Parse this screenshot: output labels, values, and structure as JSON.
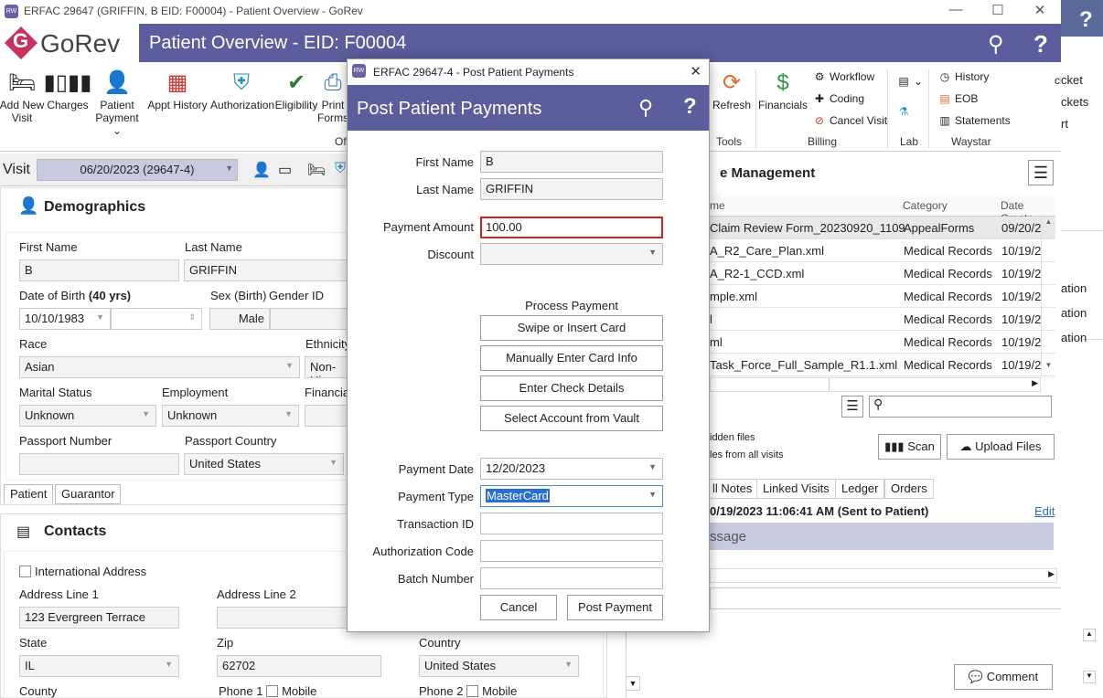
{
  "window": {
    "title": "ERFAC 29647 (GRIFFIN, B EID: F00004) - Patient Overview - GoRev",
    "minimize": "—",
    "maximize": "☐",
    "close": "✕"
  },
  "app": {
    "logo_text": "GoRev",
    "logo_letter": "G",
    "header_title": "Patient Overview - EID: F00004",
    "help": "?"
  },
  "ribbon": {
    "add_new_visit": [
      "Add New",
      "Visit"
    ],
    "charges": "Charges",
    "patient_payment": [
      "Patient",
      "Payment ⌄"
    ],
    "appt_history": "Appt History",
    "authorization": "Authorization",
    "eligibility": "Eligibility",
    "print_forms": [
      "Print",
      "Forms"
    ],
    "group_of": "Of",
    "refresh": "Refresh",
    "tools": "Tools",
    "financials": "Financials",
    "workflow": "Workflow",
    "coding": "Coding",
    "cancel_visit": "Cancel Visit",
    "billing": "Billing",
    "lab": "Lab",
    "history": "History",
    "eob": "EOB",
    "statements": "Statements",
    "waystar": "Waystar",
    "partial1": "cket",
    "partial2": "ckets",
    "partial3": "rt"
  },
  "visit": {
    "label": "Visit",
    "selected": "06/20/2023 (29647-4)"
  },
  "demographics": {
    "title": "Demographics",
    "first_name_label": "First Name",
    "first_name": "B",
    "last_name_label": "Last Name",
    "last_name": "GRIFFIN",
    "dob_label": "Date of Birth",
    "age": "(40 yrs)",
    "dob": "10/10/1983",
    "sex_label": "Sex (Birth)",
    "sex": "Male",
    "gender_label": "Gender ID",
    "race_label": "Race",
    "race": "Asian",
    "ethnicity_label": "Ethnicity",
    "ethnicity": "Non-Hi",
    "marital_label": "Marital Status",
    "marital": "Unknown",
    "employment_label": "Employment",
    "employment": "Unknown",
    "financial_label": "Financia",
    "passport_label": "Passport Number",
    "passport_country_label": "Passport Country",
    "passport_country": "United States",
    "tab_patient": "Patient",
    "tab_guarantor": "Guarantor"
  },
  "contacts": {
    "title": "Contacts",
    "intl": "International Address",
    "addr1_label": "Address Line 1",
    "addr1": "123 Evergreen Terrace",
    "addr2_label": "Address Line 2",
    "state_label": "State",
    "state": "IL",
    "zip_label": "Zip",
    "zip": "62702",
    "country_label": "Country",
    "country": "United States",
    "county_label": "County",
    "phone1_label": "Phone 1",
    "mobile": "Mobile",
    "phone2_label": "Phone 2"
  },
  "files": {
    "title": "e Management",
    "col_name": "me",
    "col_category": "Category",
    "col_date": "Date Create",
    "rows": [
      {
        "name": "Claim Review Form_20230920_1109",
        "category": "AppealForms",
        "date": "09/20/2"
      },
      {
        "name": "A_R2_Care_Plan.xml",
        "category": "Medical Records",
        "date": "10/19/2"
      },
      {
        "name": "A_R2-1_CCD.xml",
        "category": "Medical Records",
        "date": "10/19/2"
      },
      {
        "name": "mple.xml",
        "category": "Medical Records",
        "date": "10/19/2"
      },
      {
        "name": "l",
        "category": "Medical Records",
        "date": "10/19/2"
      },
      {
        "name": "ml",
        "category": "Medical Records",
        "date": "10/19/2"
      },
      {
        "name": "Task_Force_Full_Sample_R1.1.xml",
        "category": "Medical Records",
        "date": "10/19/2"
      }
    ],
    "hidden_files": "idden files",
    "all_visits": "les from all visits",
    "scan": "Scan",
    "upload": "Upload Files",
    "side1": "ation",
    "side2": "ation",
    "side3": "ation"
  },
  "notes": {
    "tabs": [
      "ll Notes",
      "Linked Visits",
      "Ledger",
      "Orders"
    ],
    "entry": "0/19/2023 11:06:41 AM (Sent to Patient)",
    "edit": "Edit",
    "message": "ssage",
    "comment": "Comment"
  },
  "modal": {
    "window_title": "ERFAC 29647-4 - Post Patient Payments",
    "header": "Post Patient Payments",
    "close": "✕",
    "first_name_label": "First Name",
    "first_name": "B",
    "last_name_label": "Last Name",
    "last_name": "GRIFFIN",
    "amount_label": "Payment Amount",
    "amount": "100.00",
    "discount_label": "Discount",
    "process_label": "Process Payment",
    "swipe": "Swipe or Insert Card",
    "manual": "Manually Enter Card Info",
    "check": "Enter Check Details",
    "vault": "Select Account from Vault",
    "date_label": "Payment Date",
    "date": "12/20/2023",
    "type_label": "Payment Type",
    "type": "MasterCard",
    "txn_label": "Transaction ID",
    "auth_label": "Authorization Code",
    "batch_label": "Batch Number",
    "cancel": "Cancel",
    "post": "Post Payment"
  },
  "colors": {
    "brand": "#5b5d9c",
    "accent": "#c8325a",
    "required_border": "#d02020"
  }
}
